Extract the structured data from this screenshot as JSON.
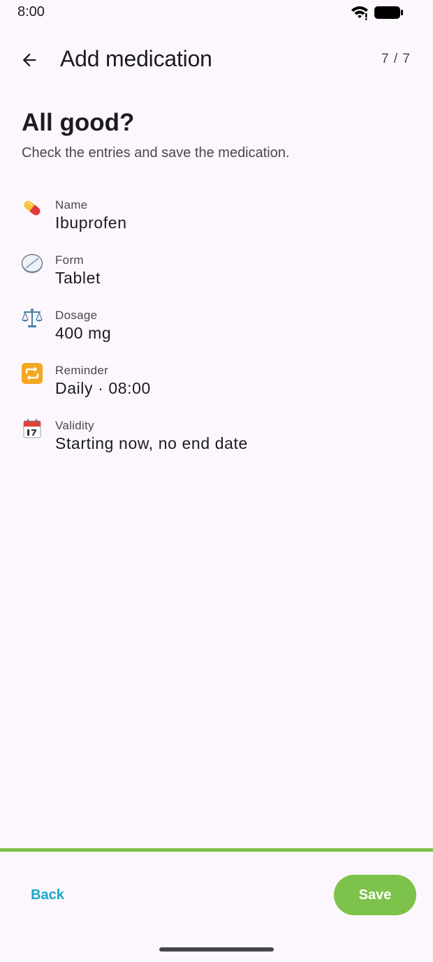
{
  "status_bar": {
    "time": "8:00",
    "icons": [
      "wifi-icon",
      "battery-icon"
    ]
  },
  "app_bar": {
    "back_icon": "arrow-back-icon",
    "title": "Add medication",
    "step_counter": "7 / 7"
  },
  "heading": "All good?",
  "subheading": "Check the entries and save the medication.",
  "summary": [
    {
      "icon": "pill-icon",
      "label": "Name",
      "value": "Ibuprofen"
    },
    {
      "icon": "tablet-icon",
      "label": "Form",
      "value": "Tablet"
    },
    {
      "icon": "scales-icon",
      "label": "Dosage",
      "value": "400 mg"
    },
    {
      "icon": "repeat-icon",
      "label": "Reminder",
      "value": "Daily · 08:00"
    },
    {
      "icon": "calendar-icon",
      "label": "Validity",
      "value": "Starting now, no end date"
    }
  ],
  "progress": {
    "fraction": 1.0
  },
  "footer": {
    "back_label": "Back",
    "save_label": "Save"
  },
  "colors": {
    "background": "#FCF7FC",
    "accent_green": "#7DC24A",
    "link_blue": "#1AA6C9",
    "text_primary": "#1D1B20",
    "text_secondary": "#49454F"
  }
}
